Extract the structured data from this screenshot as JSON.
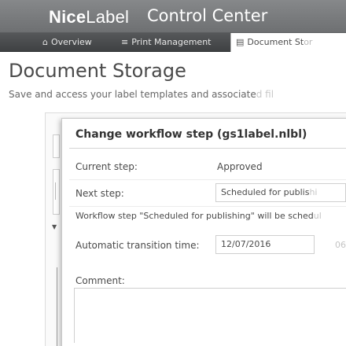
{
  "header": {
    "logo_nice": "Nice",
    "logo_label": "Label",
    "app_title": "Control Center"
  },
  "nav": {
    "overview": "Overview",
    "print_management": "Print Management",
    "document_storage_visible": "Document St",
    "document_storage_faded": "or"
  },
  "page": {
    "title": "Document Storage",
    "subtitle_visible": "Save and access your label templates and associate",
    "subtitle_faded": "d fil"
  },
  "dialog": {
    "title": "Change workflow step (gs1label.nlbl)",
    "current_step_label": "Current step:",
    "current_step_value": "Approved",
    "next_step_label": "Next step:",
    "next_step_value_visible": "Scheduled for publis",
    "next_step_value_faded": "hi",
    "info_text_visible": "Workflow step \"Scheduled for publishing\" will be sched",
    "info_text_faded": "ul",
    "auto_transition_label": "Automatic transition time:",
    "auto_transition_date": "12/07/2016",
    "auto_transition_time_faded": "06",
    "comment_label": "Comment:"
  },
  "colors": {
    "header_bg": "#7a7c7e",
    "nav_bg": "#4a4c4e",
    "text": "#4a4a4a"
  },
  "icons": {
    "overview": "home-icon",
    "print_management": "print-management-icon",
    "document_storage": "document-storage-icon"
  }
}
